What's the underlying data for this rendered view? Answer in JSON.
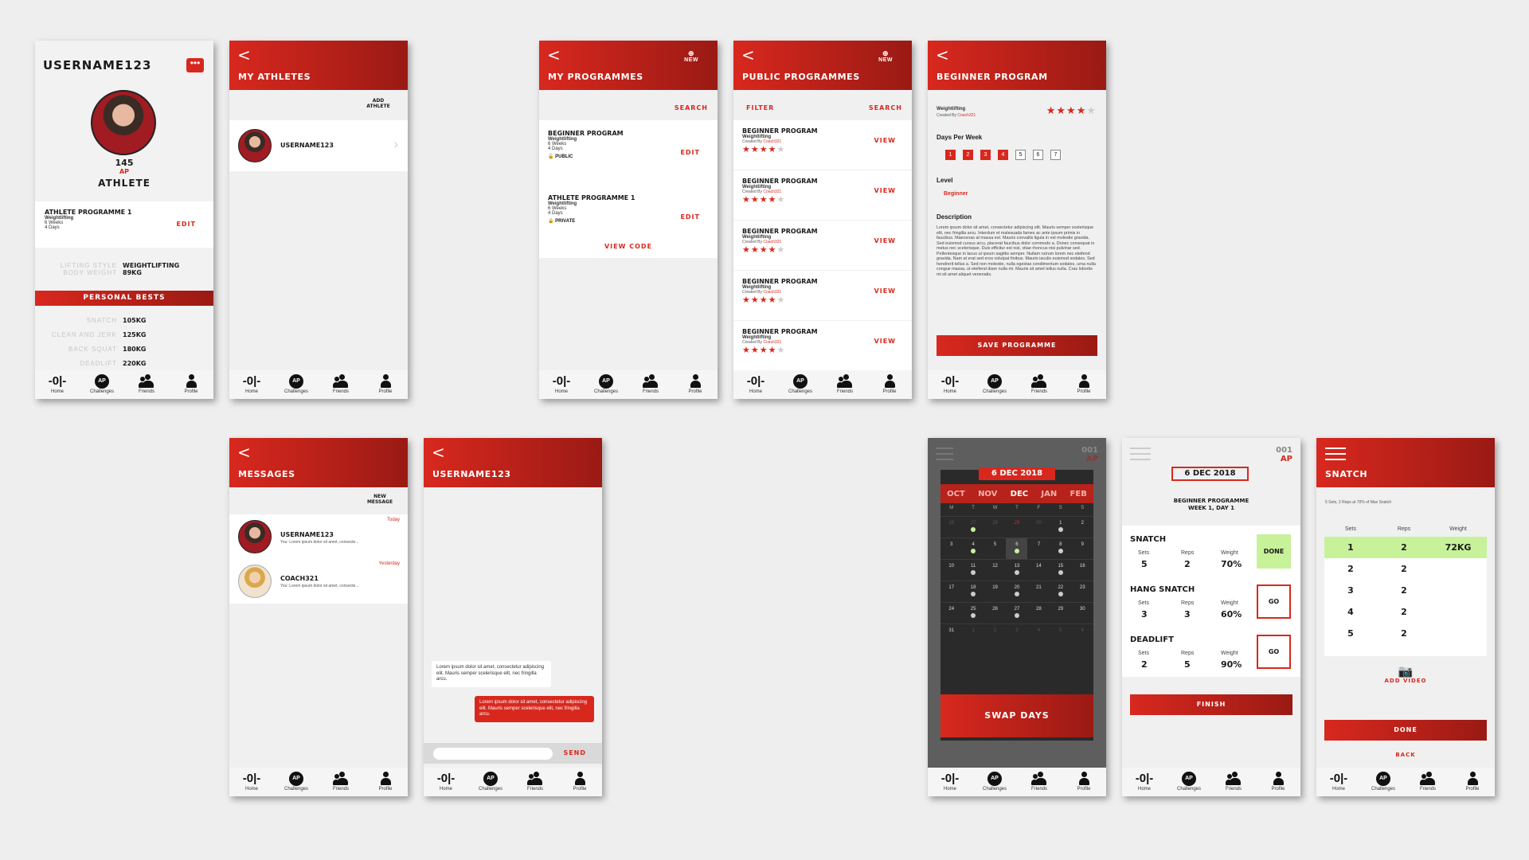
{
  "colors": {
    "accent": "#d8281e",
    "done_green": "#c7f29a"
  },
  "nav": {
    "home": "Home",
    "challenges": "Challenges",
    "friends": "Friends",
    "profile": "Profile",
    "ap": "AP"
  },
  "profile": {
    "username": "USERNAME123",
    "points": "145",
    "points_unit": "AP",
    "role": "ATHLETE",
    "programme": {
      "name": "ATHLETE PROGRAMME 1",
      "type": "Weightlifting",
      "weeks": "6 Weeks",
      "days": "4 Days",
      "edit": "EDIT"
    },
    "lifting_style_label": "LIFTING STYLE",
    "lifting_style": "WEIGHTLIFTING",
    "body_weight_label": "BODY WEIGHT",
    "body_weight": "89KG",
    "personal_bests_title": "PERSONAL BESTS",
    "bests": [
      {
        "label": "SNATCH",
        "value": "105KG"
      },
      {
        "label": "CLEAN AND JERK",
        "value": "125KG"
      },
      {
        "label": "BACK SQUAT",
        "value": "180KG"
      },
      {
        "label": "DEADLIFT",
        "value": "220KG"
      }
    ]
  },
  "my_athletes": {
    "title": "MY ATHLETES",
    "add_athlete": "ADD ATHLETE",
    "athlete": "USERNAME123"
  },
  "my_programmes": {
    "title": "MY PROGRAMMES",
    "new": "NEW",
    "search": "SEARCH",
    "items": [
      {
        "name": "BEGINNER PROGRAM",
        "type": "Weightlifting",
        "weeks": "6 Weeks",
        "days": "4 Days",
        "edit": "EDIT",
        "privacy": "PUBLIC"
      },
      {
        "name": "ATHLETE PROGRAMME 1",
        "type": "Weightlifting",
        "weeks": "6 Weeks",
        "days": "4 Days",
        "edit": "EDIT",
        "privacy": "PRIVATE"
      }
    ],
    "view_code": "VIEW CODE"
  },
  "public_programmes": {
    "title": "PUBLIC PROGRAMMES",
    "new": "NEW",
    "filter": "FILTER",
    "search": "SEARCH",
    "created_by": "Created By",
    "coach": "Coach321",
    "view": "VIEW",
    "items": [
      {
        "name": "BEGINNER PROGRAM",
        "type": "Weightlifting",
        "rating": 4
      },
      {
        "name": "BEGINNER PROGRAM",
        "type": "Weightlifting",
        "rating": 4
      },
      {
        "name": "BEGINNER PROGRAM",
        "type": "Weightlifting",
        "rating": 4
      },
      {
        "name": "BEGINNER PROGRAM",
        "type": "Weightlifting",
        "rating": 4
      },
      {
        "name": "BEGINNER PROGRAM",
        "type": "Weightlifting",
        "rating": 4
      }
    ]
  },
  "beginner": {
    "title": "BEGINNER PROGRAM",
    "type": "Weightlifting",
    "created_by": "Created By",
    "coach": "Coach321",
    "rating": 4,
    "days_per_week_label": "Days Per Week",
    "days": [
      "1",
      "2",
      "3",
      "4",
      "5",
      "6",
      "7"
    ],
    "days_selected": 4,
    "level_label": "Level",
    "level": "Beginner",
    "description_label": "Description",
    "description": "Lorem ipsum dolor sit amet, consectetur adipiscing elit. Mauris semper scelerisque elit, nec fringilla arcu. Interdum et malesuada fames ac ante ipsum primis in faucibus. Maecenas at massa est. Mauris convallis ligula in est molestie gravida. Sed euismod cursus arcu, placerat faucibus dolor commodo a. Donec consequat in metus nec scelerisque. Duis efficitur est nisl, vitae rhoncus nisi pulvinar sed. Pellentesque in lacus ut ipsum sagittis semper. Nullam rutrum lorem nec eleifend gravida. Nam at erat sed eros volutpat finibus. Mauris iaculis euismod sodales. Sed hendrerit tellus a. Sed non molestie, nulla egestas condimentum sodales, urna nulla congue massa, ut eleifend diam nulla mi. Mauris sit amet tellus nulla. Cras lobortis mi sit amet aliquet venenatis.",
    "save": "SAVE PROGRAMME"
  },
  "messages": {
    "title": "MESSAGES",
    "new_message": "NEW MESSAGE",
    "threads": [
      {
        "name": "USERNAME123",
        "preview": "You: Lorem ipsum dolor sit amet, consecte...",
        "time": "Today"
      },
      {
        "name": "COACH321",
        "preview": "You: Lorem ipsum dolor sit amet, consecte...",
        "time": "Yesterday"
      }
    ]
  },
  "chat": {
    "title": "USERNAME123",
    "incoming": "Lorem ipsum dolor sit amet, consectetur adipiscing elit. Mauris semper scelerisque elit, nec fringilla arcu.",
    "outgoing": "Lorem ipsum dolor sit amet, consectetur adipiscing elit. Mauris semper scelerisque elit, nec fringilla arcu.",
    "send": "SEND"
  },
  "calendar": {
    "points": "001",
    "points_unit": "AP",
    "date": "6 DEC 2018",
    "months": [
      "OCT",
      "NOV",
      "DEC",
      "JAN",
      "FEB"
    ],
    "active_month": "DEC",
    "weekdays": [
      "M",
      "T",
      "W",
      "T",
      "F",
      "S",
      "S"
    ],
    "weeks": [
      [
        "26",
        "27",
        "28",
        "29",
        "30",
        "1",
        "2"
      ],
      [
        "3",
        "4",
        "5",
        "6",
        "7",
        "8",
        "9"
      ],
      [
        "10",
        "11",
        "12",
        "13",
        "14",
        "15",
        "16"
      ],
      [
        "17",
        "18",
        "19",
        "20",
        "21",
        "22",
        "23"
      ],
      [
        "24",
        "25",
        "26",
        "27",
        "28",
        "29",
        "30"
      ],
      [
        "31",
        "1",
        "2",
        "3",
        "4",
        "5",
        "6"
      ]
    ],
    "swap": "SWAP DAYS"
  },
  "workout": {
    "points": "001",
    "points_unit": "AP",
    "date": "6 DEC 2018",
    "programme": "BEGINNER PROGRAMME",
    "week": "WEEK 1, DAY 1",
    "headers": {
      "sets": "Sets",
      "reps": "Reps",
      "weight": "Weight"
    },
    "exercises": [
      {
        "name": "SNATCH",
        "sets": "5",
        "reps": "2",
        "weight": "70%",
        "action": "DONE"
      },
      {
        "name": "HANG SNATCH",
        "sets": "3",
        "reps": "3",
        "weight": "60%",
        "action": "GO"
      },
      {
        "name": "DEADLIFT",
        "sets": "2",
        "reps": "5",
        "weight": "90%",
        "action": "GO"
      }
    ],
    "finish": "FINISH"
  },
  "snatch": {
    "title": "SNATCH",
    "subtitle": "5 Sets, 2 Reps at 70% of Max Snatch",
    "headers": {
      "sets": "Sets",
      "reps": "Reps",
      "weight": "Weight"
    },
    "rows": [
      {
        "set": "1",
        "reps": "2",
        "weight": "72KG"
      },
      {
        "set": "2",
        "reps": "2",
        "weight": ""
      },
      {
        "set": "3",
        "reps": "2",
        "weight": ""
      },
      {
        "set": "4",
        "reps": "2",
        "weight": ""
      },
      {
        "set": "5",
        "reps": "2",
        "weight": ""
      }
    ],
    "add_video": "ADD VIDEO",
    "done": "DONE",
    "back": "BACK"
  }
}
